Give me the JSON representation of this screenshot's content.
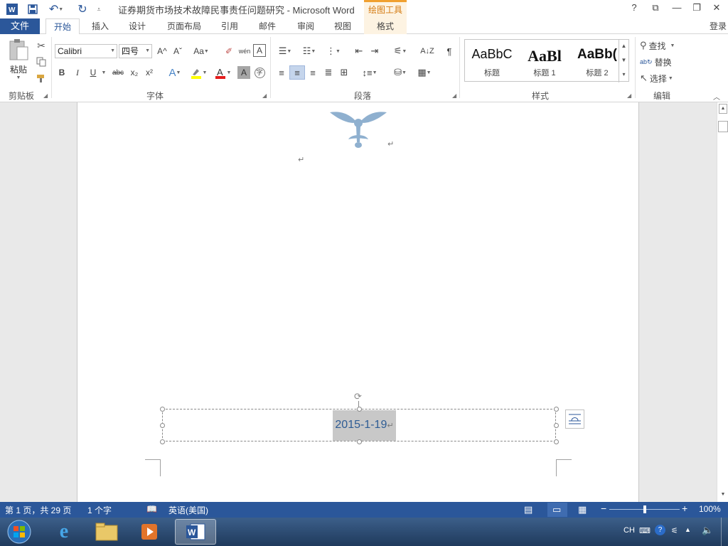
{
  "title_bar": {
    "doc_title": "证券期货市场技术故障民事责任问题研究 - Microsoft Word",
    "tools_context": "绘图工具",
    "help": "?",
    "ribbon_display": "⧉",
    "minimize": "—",
    "restore": "❐",
    "close": "✕"
  },
  "tabs": {
    "file": "文件",
    "items": [
      "开始",
      "插入",
      "设计",
      "页面布局",
      "引用",
      "邮件",
      "审阅",
      "视图",
      "格式"
    ],
    "active": "开始",
    "login": "登录"
  },
  "ribbon": {
    "clipboard": {
      "paste": "粘贴",
      "label": "剪贴板"
    },
    "font": {
      "name": "Calibri",
      "size": "四号",
      "label": "字体",
      "bold": "B",
      "italic": "I",
      "underline": "U",
      "strike": "abc",
      "sub": "x₂",
      "sup": "x²",
      "grow": "A^",
      "shrink": "Aˇ",
      "case": "Aa",
      "clear": "✐",
      "pinyin": "wén",
      "border": "A"
    },
    "paragraph": {
      "label": "段落"
    },
    "styles": {
      "label": "样式",
      "items": [
        {
          "sample": "AaBbC",
          "name": "标题"
        },
        {
          "sample": "AaBl",
          "name": "标题 1"
        },
        {
          "sample": "AaBb(",
          "name": "标题 2"
        }
      ]
    },
    "editing": {
      "find": "查找",
      "replace": "替换",
      "select": "选择",
      "label": "编辑"
    }
  },
  "document": {
    "paragraph_mark": "↵",
    "date": "2015-1-19"
  },
  "status_bar": {
    "page": "第 1 页，共 29 页",
    "words": "1 个字",
    "language": "英语(美国)",
    "zoom": "100%",
    "zoom_level": 1.0
  },
  "taskbar": {
    "tray_lang": "CH"
  },
  "colors": {
    "accent": "#2b579a",
    "tools_accent": "#d47a10",
    "date_text": "#2e5c94"
  }
}
